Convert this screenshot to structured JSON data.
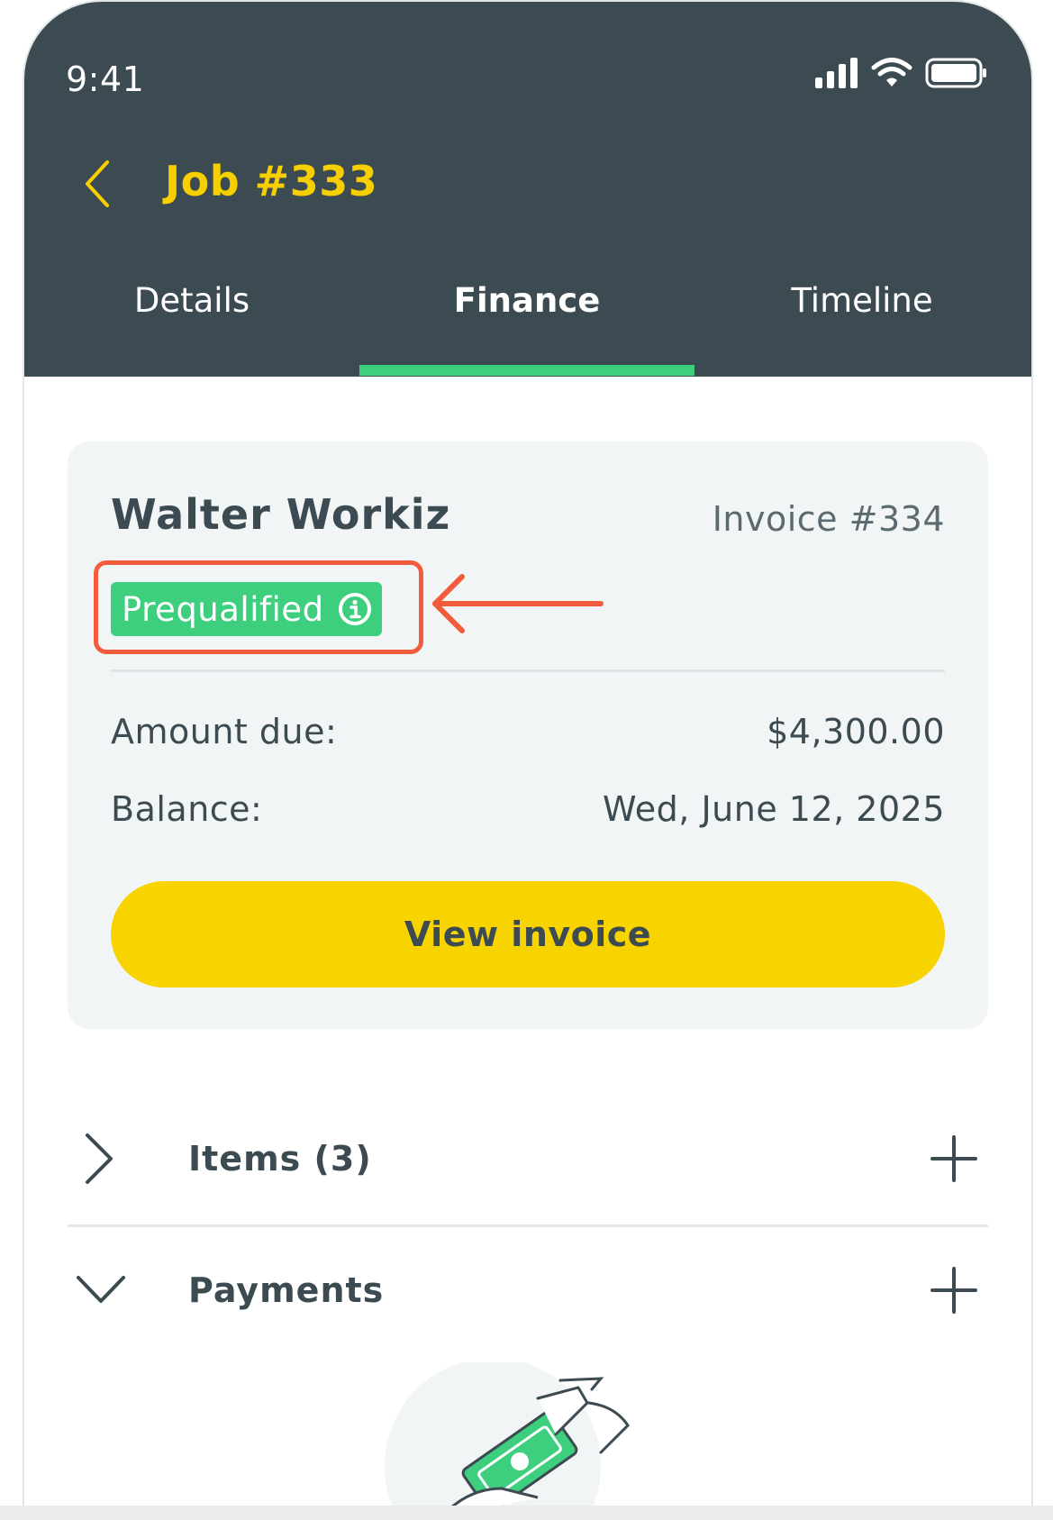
{
  "status_bar": {
    "time": "9:41",
    "icons": [
      "cellular-signal-icon",
      "wifi-icon",
      "battery-icon"
    ]
  },
  "header": {
    "title": "Job #333",
    "back_icon": "chevron-left-icon"
  },
  "tabs": [
    {
      "label": "Details",
      "active": false
    },
    {
      "label": "Finance",
      "active": true
    },
    {
      "label": "Timeline",
      "active": false
    }
  ],
  "invoice_card": {
    "customer_name": "Walter Workiz",
    "invoice_number": "Invoice #334",
    "badge": {
      "label": "Prequalified",
      "icon": "info-icon",
      "color": "#3ecf7e"
    },
    "highlight_color": "#f25c3d",
    "rows": [
      {
        "label": "Amount due:",
        "value": "$4,300.00"
      },
      {
        "label": "Balance:",
        "value": "Wed, June 12, 2025"
      }
    ],
    "button_label": "View invoice"
  },
  "sections": [
    {
      "label": "Items (3)",
      "expanded": false,
      "chevron_icon": "chevron-right-icon",
      "add_icon": "plus-icon"
    },
    {
      "label": "Payments",
      "expanded": true,
      "chevron_icon": "chevron-down-icon",
      "add_icon": "plus-icon"
    }
  ],
  "colors": {
    "header_bg": "#3c4a51",
    "accent_yellow": "#f7d300",
    "accent_green": "#3ecf7e",
    "text_dark": "#3c4a51"
  }
}
